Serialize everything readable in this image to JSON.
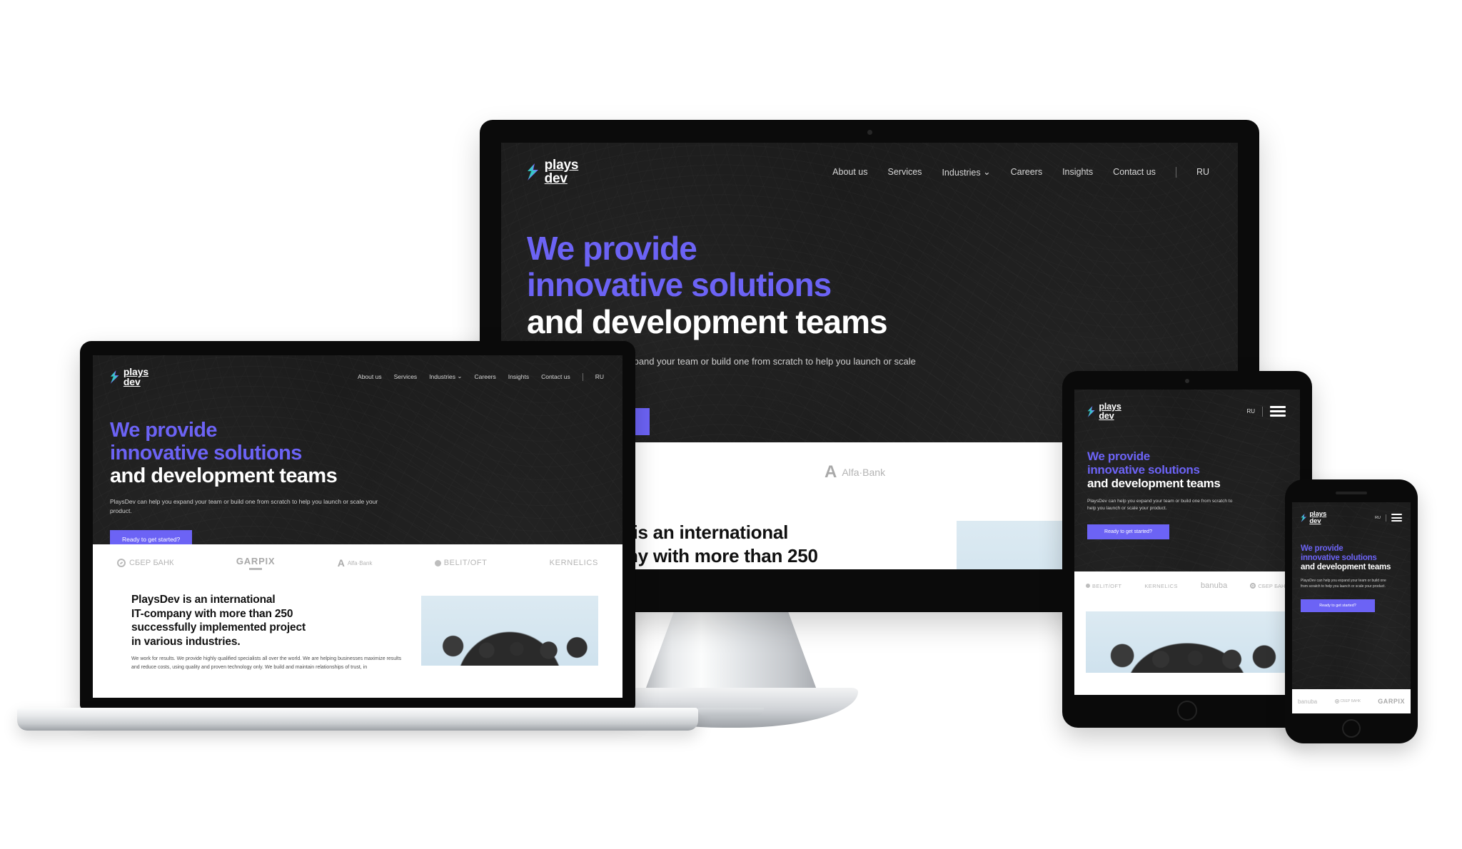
{
  "site": {
    "brand": {
      "line1": "plays",
      "line2": "dev",
      "bolt_icon": "lightning-bolt-icon"
    },
    "nav": [
      {
        "label": "About us"
      },
      {
        "label": "Services"
      },
      {
        "label": "Industries",
        "has_dropdown": true,
        "chevron": "⌄"
      },
      {
        "label": "Careers"
      },
      {
        "label": "Insights"
      },
      {
        "label": "Contact us"
      }
    ],
    "lang": "RU",
    "menu_icon": "hamburger-menu-icon",
    "hero": {
      "line1": "We provide",
      "line2": "innovative solutions",
      "line3": "and development teams",
      "subtitle": "PlaysDev can help you expand your team or build one from scratch to help you launch or scale your product.",
      "subtitle_tablet": "PlaysDev can help you expand your team or build one from scratch to help you launch or scale your product.",
      "cta_label": "Ready to get started?"
    },
    "clients": [
      {
        "name": "СБЕР БАНК",
        "key": "sber"
      },
      {
        "name": "GARPIX",
        "key": "garpix"
      },
      {
        "name": "Alfa·Bank",
        "key": "alfa"
      },
      {
        "name": "BELIT/OFT",
        "key": "belit"
      },
      {
        "name": "KERNELICS",
        "key": "kernelics"
      },
      {
        "name": "banuba",
        "key": "banuba"
      }
    ],
    "about": {
      "heading_l1": "PlaysDev is an international",
      "heading_l2": "IT-company with more than 250",
      "heading_l3": "successfully implemented project",
      "heading_l4": "in various industries.",
      "body": "We work for results. We provide highly qualified specialists all over the world. We are helping businesses maximize results and reduce costs, using quality and proven technology only. We build and maintain relationships of trust, in",
      "photo_alt": "team-photo"
    }
  },
  "colors": {
    "accent": "#6C63F5",
    "dark_bg": "#1a1a1a",
    "device_black": "#0a0a0a",
    "silver": "#d5d8db",
    "logo_gray": "#b4b4b4"
  },
  "devices": [
    {
      "name": "desktop-monitor",
      "type": "imac"
    },
    {
      "name": "laptop",
      "type": "macbook"
    },
    {
      "name": "tablet",
      "type": "ipad"
    },
    {
      "name": "phone",
      "type": "iphone"
    }
  ]
}
